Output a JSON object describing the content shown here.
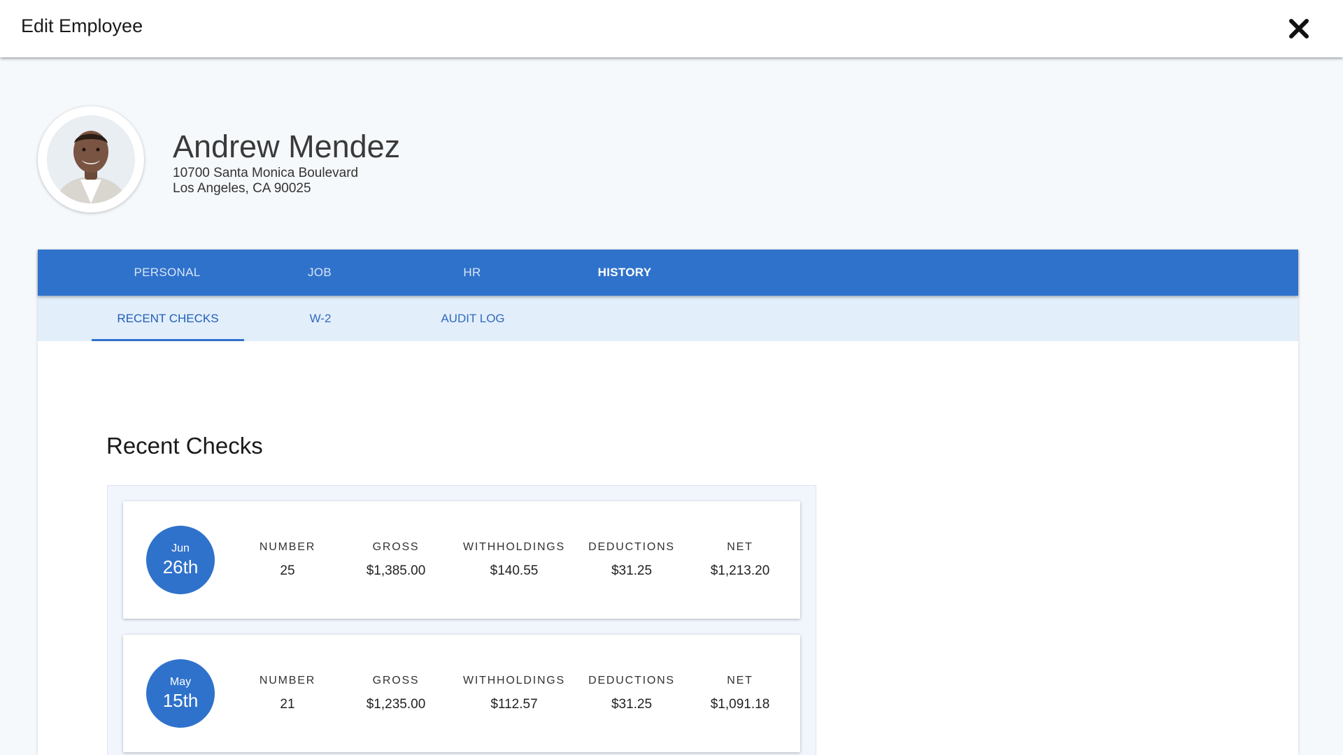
{
  "header": {
    "title": "Edit Employee",
    "close_icon": "close-icon"
  },
  "profile": {
    "name": "Andrew Mendez",
    "address_line1": "10700 Santa Monica Boulevard",
    "address_line2": "Los Angeles, CA 90025",
    "avatar_icon": "avatar-photo"
  },
  "tabs": [
    {
      "label": "PERSONAL",
      "active": false
    },
    {
      "label": "JOB",
      "active": false
    },
    {
      "label": "HR",
      "active": false
    },
    {
      "label": "HISTORY",
      "active": true
    }
  ],
  "subtabs": [
    {
      "label": "RECENT CHECKS",
      "active": true
    },
    {
      "label": "W-2",
      "active": false
    },
    {
      "label": "AUDIT LOG",
      "active": false
    }
  ],
  "recent_checks": {
    "title": "Recent Checks",
    "columns": [
      "NUMBER",
      "GROSS",
      "WITHHOLDINGS",
      "DEDUCTIONS",
      "NET"
    ],
    "checks": [
      {
        "month": "Jun",
        "day": "26th",
        "number": "25",
        "gross": "$1,385.00",
        "withholdings": "$140.55",
        "deductions": "$31.25",
        "net": "$1,213.20"
      },
      {
        "month": "May",
        "day": "15th",
        "number": "21",
        "gross": "$1,235.00",
        "withholdings": "$112.57",
        "deductions": "$31.25",
        "net": "$1,091.18"
      }
    ]
  },
  "colors": {
    "primary": "#2f72cb",
    "subtab_bg": "#e3eefb",
    "page_bg": "#f6f9fc"
  }
}
